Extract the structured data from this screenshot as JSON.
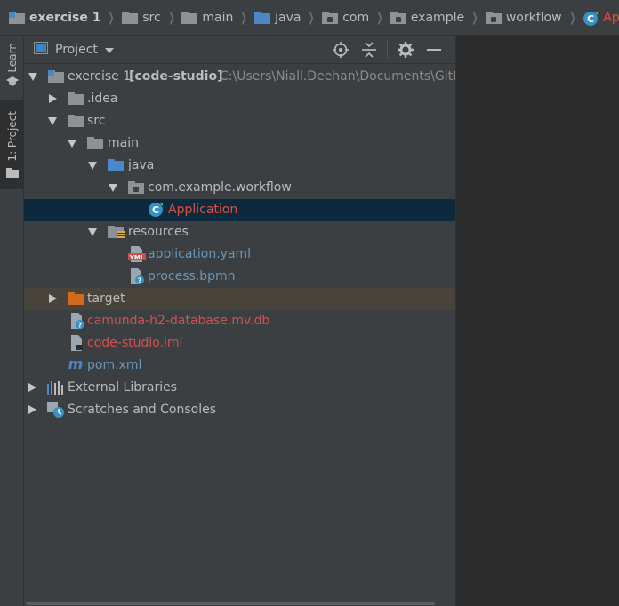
{
  "breadcrumb": {
    "items": [
      {
        "label": "exercise 1",
        "icon": "module-folder-icon"
      },
      {
        "label": "src",
        "icon": "folder-icon"
      },
      {
        "label": "main",
        "icon": "folder-icon"
      },
      {
        "label": "java",
        "icon": "source-folder-icon"
      },
      {
        "label": "com",
        "icon": "package-icon"
      },
      {
        "label": "example",
        "icon": "package-icon"
      },
      {
        "label": "workflow",
        "icon": "package-icon"
      },
      {
        "label": "Application",
        "icon": "spring-boot-class-icon"
      }
    ]
  },
  "tool_strip": {
    "learn_label": "Learn",
    "project_label": "1: Project"
  },
  "panel": {
    "title": "Project",
    "tools": [
      "locate-icon",
      "collapse-all-icon",
      "gear-icon",
      "hide-icon"
    ]
  },
  "tree": {
    "root_name": "exercise 1",
    "root_module": "[code-studio]",
    "root_path": "C:\\Users\\Niall.Deehan\\Documents\\GitHu",
    "idea": ".idea",
    "src": "src",
    "main": "main",
    "java": "java",
    "package": "com.example.workflow",
    "application": "Application",
    "resources": "resources",
    "application_yaml": "application.yaml",
    "process_bpmn": "process.bpmn",
    "target": "target",
    "db_file": "camunda-h2-database.mv.db",
    "iml_file": "code-studio.iml",
    "pom": "pom.xml",
    "external_libraries": "External Libraries",
    "scratches": "Scratches and Consoles"
  },
  "colors": {
    "selected_row": "#0d293e",
    "excluded_row": "#49443b",
    "accent_red": "#e0503e",
    "link_blue": "#6897bb"
  }
}
